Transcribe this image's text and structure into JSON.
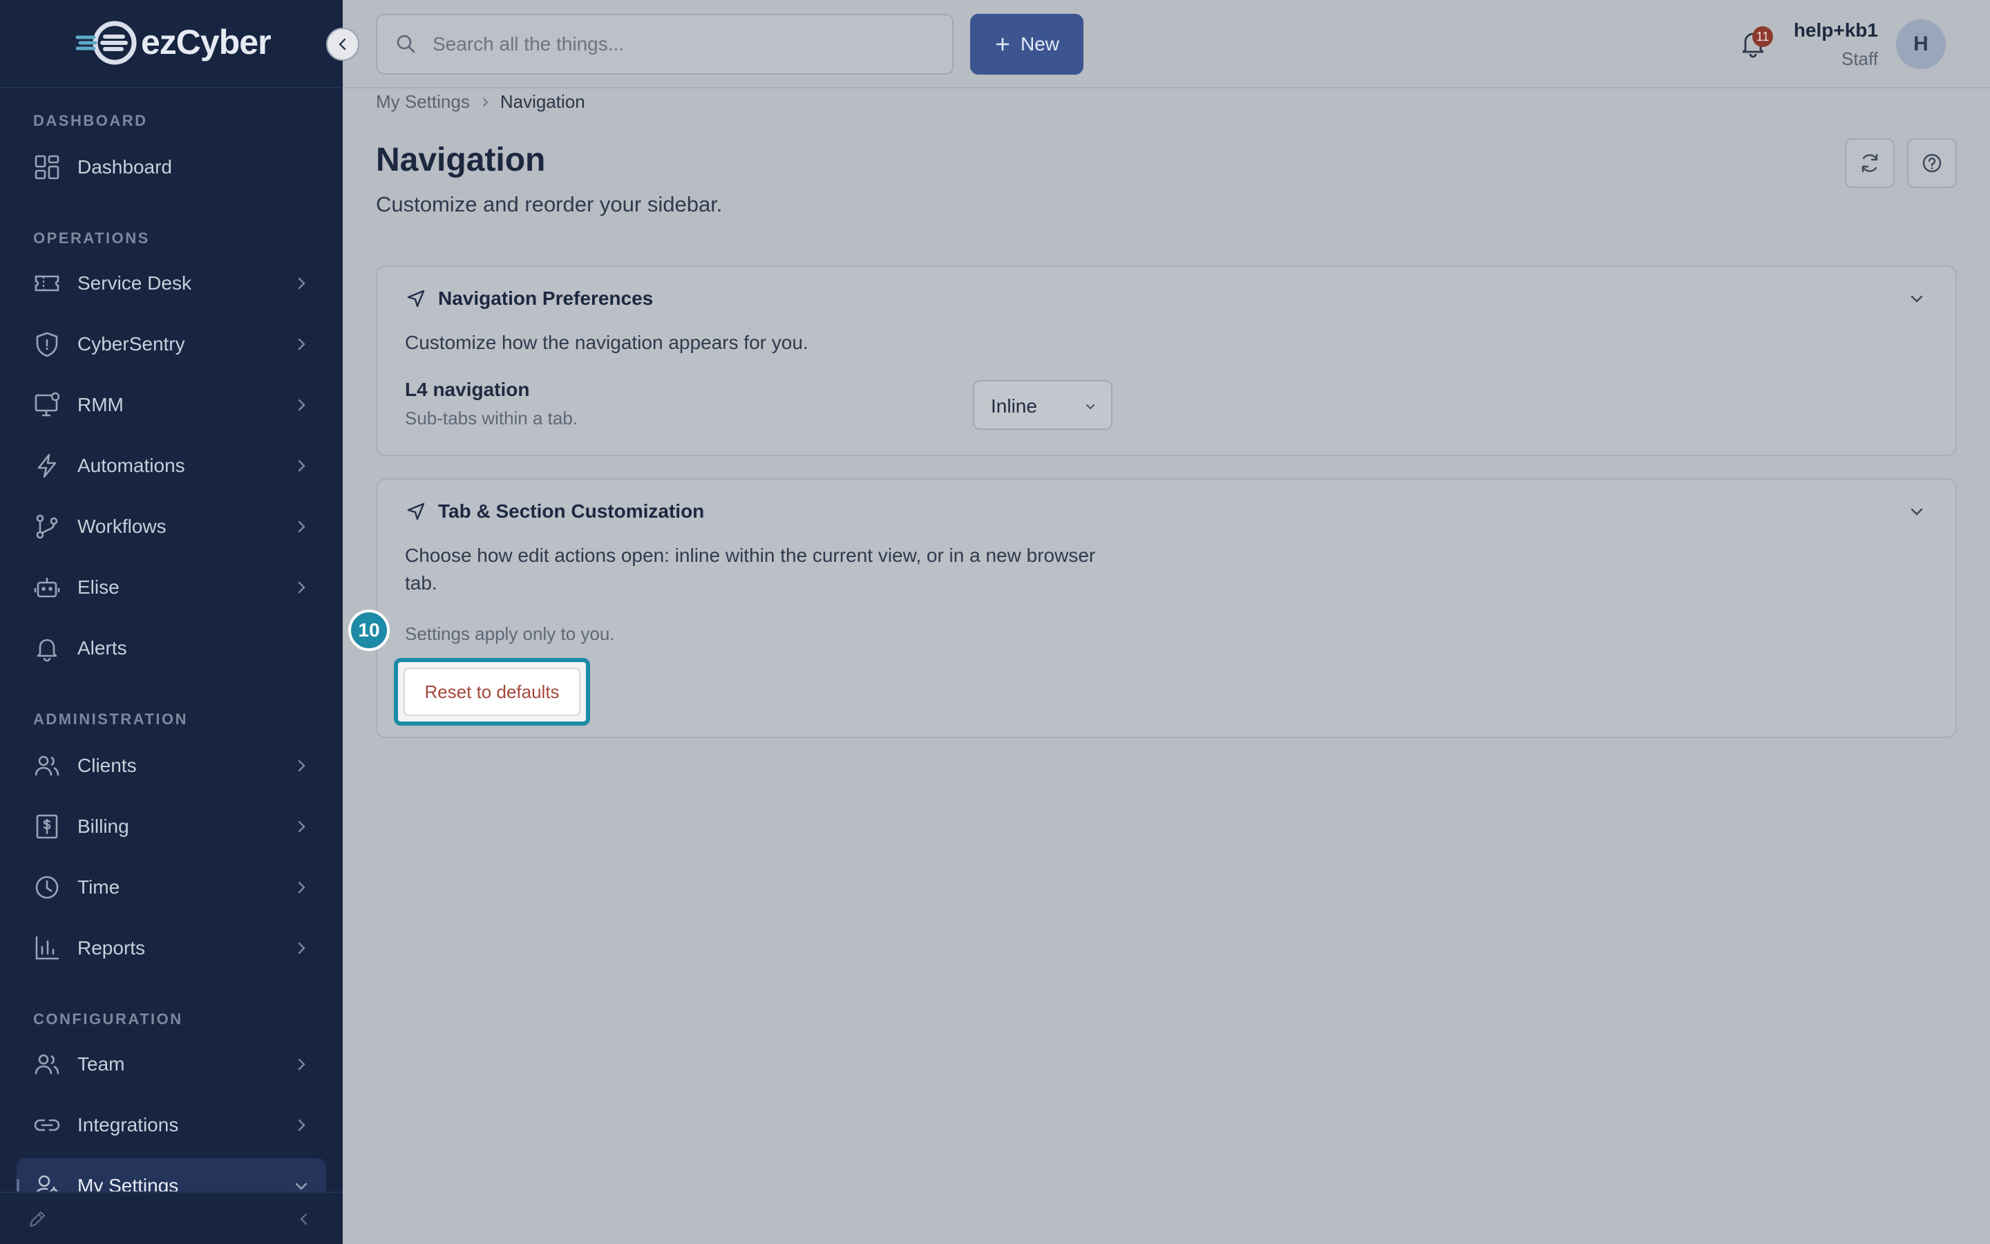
{
  "brand": {
    "name": "ezCyber"
  },
  "sidebar": {
    "sections": [
      {
        "title": "DASHBOARD"
      },
      {
        "title": "OPERATIONS"
      },
      {
        "title": "ADMINISTRATION"
      },
      {
        "title": "CONFIGURATION"
      }
    ],
    "items": [
      {
        "label": "Dashboard",
        "icon": "dashboard-grid-icon"
      },
      {
        "label": "Service Desk",
        "icon": "ticket-icon"
      },
      {
        "label": "CyberSentry",
        "icon": "shield-icon"
      },
      {
        "label": "RMM",
        "icon": "monitor-icon"
      },
      {
        "label": "Automations",
        "icon": "lightning-icon"
      },
      {
        "label": "Workflows",
        "icon": "git-branch-icon"
      },
      {
        "label": "Elise",
        "icon": "robot-icon"
      },
      {
        "label": "Alerts",
        "icon": "bell-icon"
      },
      {
        "label": "Clients",
        "icon": "users-icon"
      },
      {
        "label": "Billing",
        "icon": "dollar-receipt-icon"
      },
      {
        "label": "Time",
        "icon": "clock-icon"
      },
      {
        "label": "Reports",
        "icon": "bar-chart-icon"
      },
      {
        "label": "Team",
        "icon": "team-icon"
      },
      {
        "label": "Integrations",
        "icon": "link-icon"
      },
      {
        "label": "My Settings",
        "icon": "user-settings-icon",
        "active": true,
        "expanded": true
      }
    ]
  },
  "topbar": {
    "search_placeholder": "Search all the things...",
    "new_label": "New",
    "notification_count": "11",
    "user_name": "help+kb1",
    "user_role": "Staff",
    "avatar_initial": "H"
  },
  "breadcrumb": {
    "parent": "My Settings",
    "current": "Navigation"
  },
  "page": {
    "title": "Navigation",
    "subtitle": "Customize and reorder your sidebar."
  },
  "cards": {
    "prefs": {
      "title": "Navigation Preferences",
      "description": "Customize how the navigation appears for you.",
      "option_label": "L4 navigation",
      "option_hint": "Sub-tabs within a tab.",
      "option_value": "Inline"
    },
    "tabs": {
      "title": "Tab & Section Customization",
      "description": "Choose how edit actions open: inline within the current view, or in a new browser tab.",
      "note": "Settings apply only to you.",
      "reset_label": "Reset to defaults"
    }
  },
  "tutorial": {
    "step": "10"
  },
  "colors": {
    "sidebar_bg": "#172541",
    "accent": "#3c5591",
    "highlight": "#1e8ba6",
    "danger_text": "#a3473c"
  }
}
